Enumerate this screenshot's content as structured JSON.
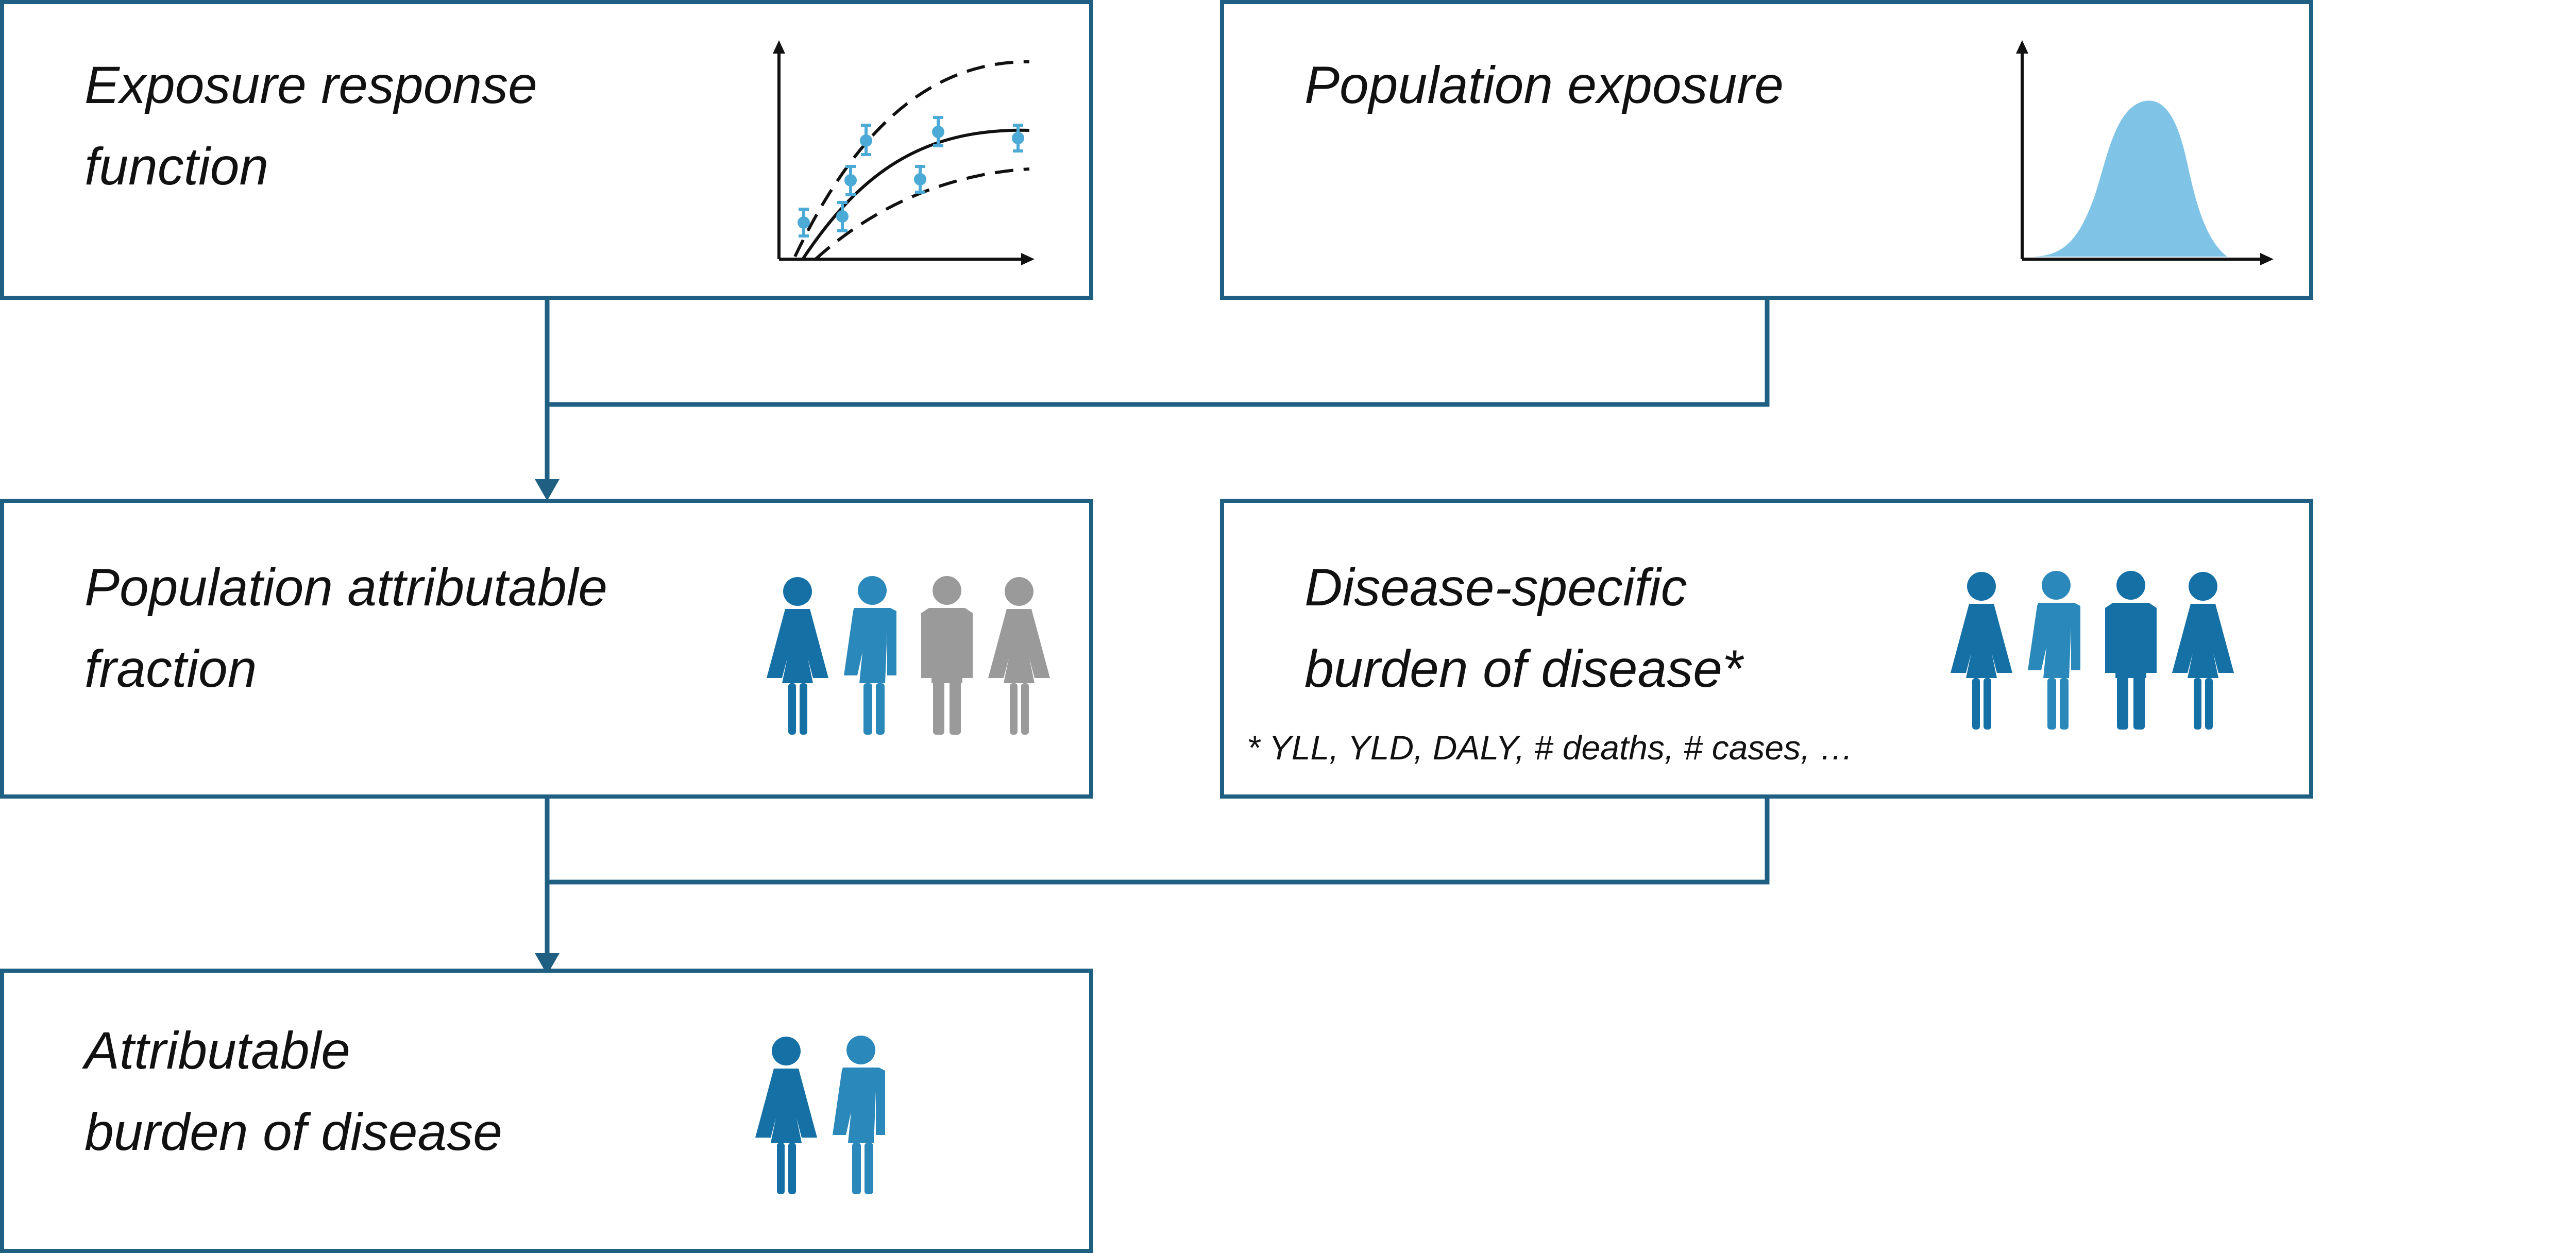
{
  "colors": {
    "box_border": "#1f5f82",
    "connector": "#1f5f82",
    "axis": "#111111",
    "person_dark": "#1570a6",
    "person_mid": "#2a88bb",
    "person_gray": "#9a9a9a",
    "error_points": "#4baad6",
    "distribution_fill": "#7fc4e6"
  },
  "boxes": {
    "exposure_response": {
      "title": "Exposure response\nfunction",
      "icon": "dose-response-curve-icon"
    },
    "population_exposure": {
      "title": "Population exposure",
      "icon": "distribution-curve-icon"
    },
    "paf": {
      "title": "Population attributable\nfraction",
      "icon": "people-group-icon"
    },
    "disease_burden": {
      "title": "Disease-specific\nburden of disease*",
      "footnote": "* YLL, YLD, DALY, # deaths, # cases, …",
      "icon": "people-group-icon"
    },
    "attributable_burden": {
      "title": "Attributable\nburden of disease",
      "icon": "people-pair-icon"
    }
  }
}
